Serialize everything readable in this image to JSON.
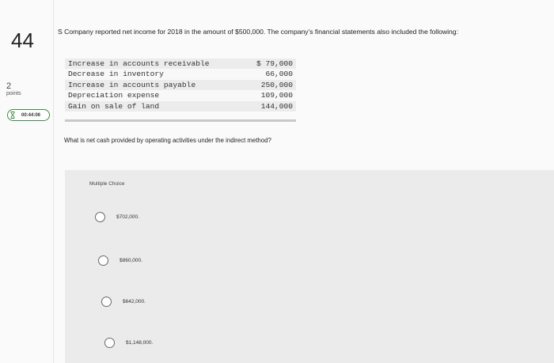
{
  "question": {
    "number": "44",
    "points_value": "2",
    "points_label": "points",
    "timer": "00:44:06",
    "text": "S Company reported net income for 2018 in the amount of $500,000. The company's financial statements also included the following:",
    "prompt": "What is net cash provided by operating activities under the indirect method?"
  },
  "table": {
    "rows": [
      {
        "item": "Increase in accounts receivable",
        "amount": "$ 79,000"
      },
      {
        "item": "Decrease in inventory",
        "amount": "66,000"
      },
      {
        "item": "Increase in accounts payable",
        "amount": "250,000"
      },
      {
        "item": "Depreciation expense",
        "amount": "109,000"
      },
      {
        "item": "Gain on sale of land",
        "amount": "144,000"
      }
    ]
  },
  "choices": {
    "label": "Multiple Choice",
    "options": [
      "$702,000.",
      "$860,000.",
      "$642,000.",
      "$1,148,000."
    ]
  },
  "colors": {
    "timer_accent": "#3e8a46",
    "panel_bg": "#ebebeb"
  }
}
